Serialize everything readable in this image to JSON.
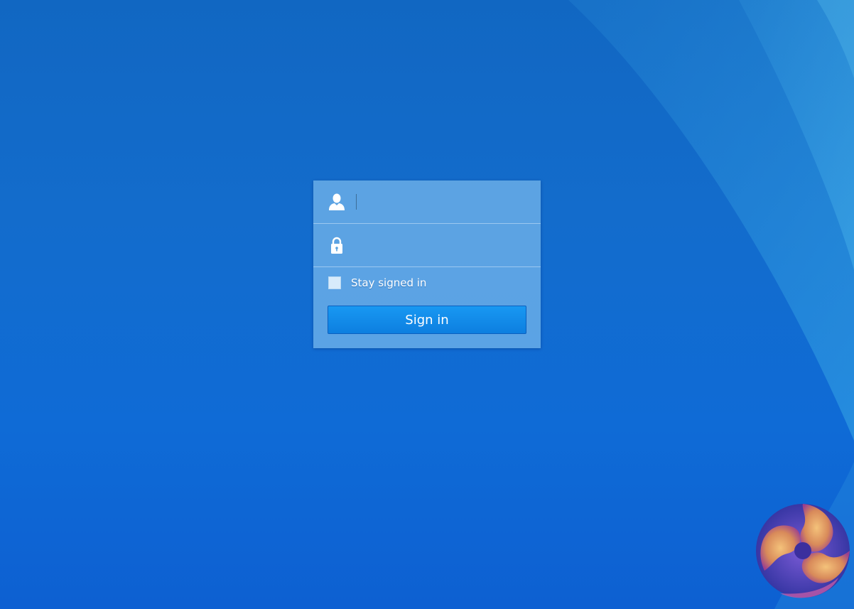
{
  "login": {
    "username": {
      "icon": "user-icon",
      "value": "",
      "placeholder": ""
    },
    "password": {
      "icon": "lock-icon",
      "value": "",
      "placeholder": ""
    },
    "stay_signed_in": {
      "label": "Stay signed in",
      "checked": false
    },
    "submit_label": "Sign in"
  },
  "colors": {
    "background": "#1167c2",
    "panel": "#63a8e4",
    "button": "#0d7fe0",
    "checkbox": "#d7ebfb"
  },
  "logo": {
    "icon": "swirl-logo-icon"
  }
}
